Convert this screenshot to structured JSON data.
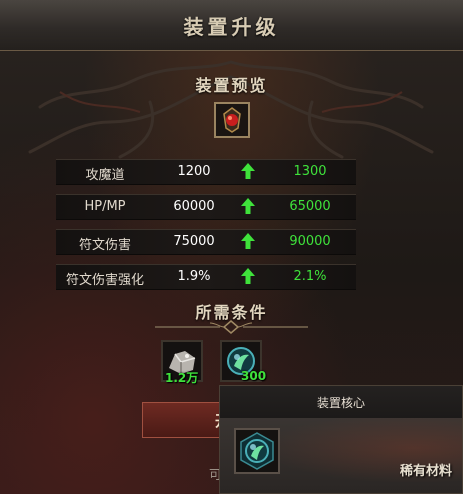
{
  "window": {
    "title": "装置升级"
  },
  "preview": {
    "title": "装置预览",
    "icon": "red-gem-amulet-icon"
  },
  "stats": [
    {
      "label": "攻魔道",
      "current": "1200",
      "next": "1300"
    },
    {
      "label": "HP/MP",
      "current": "60000",
      "next": "65000"
    },
    {
      "label": "符文伤害",
      "current": "75000",
      "next": "90000"
    },
    {
      "label": "符文伤害强化",
      "current": "1.9%",
      "next": "2.1%"
    }
  ],
  "requirements": {
    "title": "所需条件",
    "materials": [
      {
        "icon": "silver-ore-icon",
        "count": "1.2万"
      },
      {
        "icon": "teal-core-orb-icon",
        "count": "300"
      }
    ]
  },
  "actions": {
    "start_label": "开始"
  },
  "footer": {
    "hint": "可装打造"
  },
  "tooltip": {
    "title": "装置核心",
    "rarity": "稀有材料",
    "icon": "teal-core-orb-icon"
  },
  "colors": {
    "increase": "#3fe23b",
    "accent": "#9a8460"
  }
}
